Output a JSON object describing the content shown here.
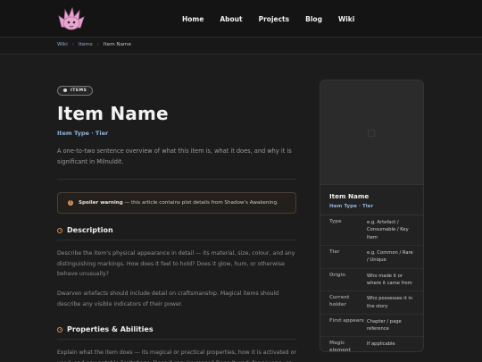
{
  "nav": {
    "links": [
      "Home",
      "About",
      "Projects",
      "Blog",
      "Wiki"
    ]
  },
  "breadcrumb": {
    "items": [
      "Wiki",
      "Items",
      "Item Name"
    ]
  },
  "article": {
    "badge": "ITEMS",
    "title": "Item Name",
    "subtitle": "Item Type · Tier",
    "lede": "A one-to-two sentence overview of what this item is, what it does, and why it is significant in Milnuldit.",
    "spoiler": {
      "label": "Spoiler warning",
      "text": " — this article contains plot details from Shadow's Awakening."
    },
    "sections": [
      {
        "heading": "Description",
        "paragraphs": [
          "Describe the item's physical appearance in detail — its material, size, colour, and any distinguishing markings. How does it feel to hold? Does it glow, hum, or otherwise behave unusually?",
          "Dwarven artefacts should include detail on craftsmanship. Magical items should describe any visible indicators of their power."
        ]
      },
      {
        "heading": "Properties & Abilities",
        "paragraphs": [
          "Explain what the item does — its magical or practical properties, how it is activated or used, and any notable limitations. Does it require mana? Does it work for anyone, or"
        ]
      }
    ]
  },
  "infobox": {
    "name": "Item Name",
    "type": "Item Type · Tier",
    "rows": [
      {
        "k": "Type",
        "v": "e.g. Artefact / Consumable / Key Item"
      },
      {
        "k": "Tier",
        "v": "e.g. Common / Rare / Unique"
      },
      {
        "k": "Origin",
        "v": "Who made it or where it came from"
      },
      {
        "k": "Current holder",
        "v": "Who possesses it in the story"
      },
      {
        "k": "First appears",
        "v": "Chapter / page reference"
      },
      {
        "k": "Magic element",
        "v": "If applicable"
      }
    ]
  },
  "colors": {
    "accent": "#8fb4d8",
    "warning": "#d9935a",
    "background": "#1c1c1c"
  }
}
